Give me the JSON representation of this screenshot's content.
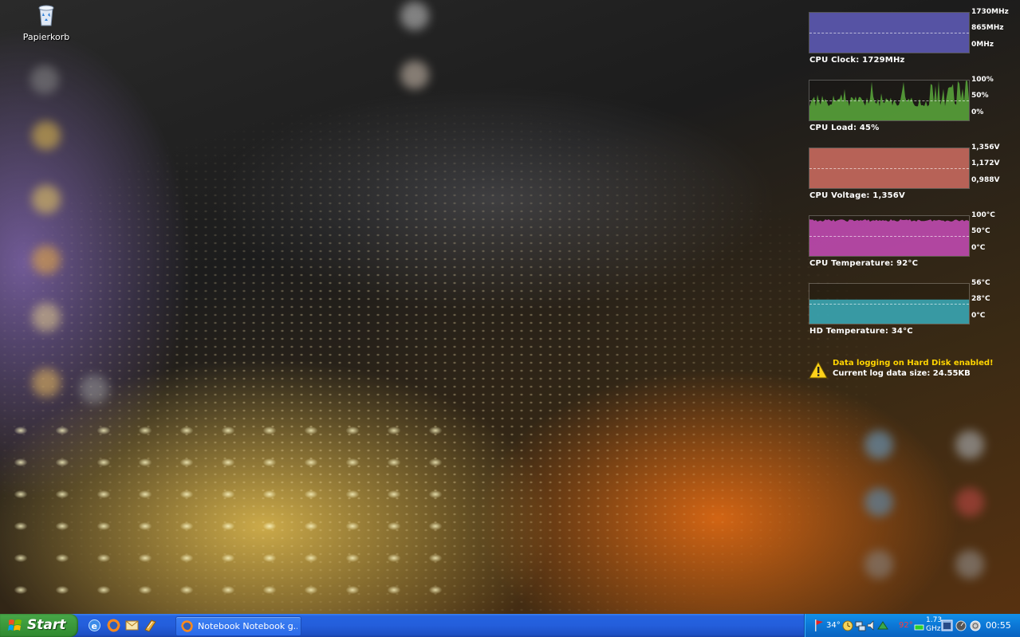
{
  "desktop": {
    "recycle_bin_label": "Papierkorb"
  },
  "monitors": [
    {
      "caption": "CPU Clock: 1729MHz",
      "ticks": [
        "1730MHz",
        "865MHz",
        "0MHz"
      ],
      "color": "#5d5ab4",
      "level": 1.0,
      "kind": "flat"
    },
    {
      "caption": "CPU Load: 45%",
      "ticks": [
        "100%",
        "50%",
        "0%"
      ],
      "color": "#58a23a",
      "level": 0.45,
      "kind": "spiky"
    },
    {
      "caption": "CPU Voltage: 1,356V",
      "ticks": [
        "1,356V",
        "1,172V",
        "0,988V"
      ],
      "color": "#c86a5e",
      "level": 1.0,
      "kind": "flat"
    },
    {
      "caption": "CPU Temperature: 92°C",
      "ticks": [
        "100°C",
        "50°C",
        "0°C"
      ],
      "color": "#c04ab0",
      "level": 0.92,
      "kind": "noisy"
    },
    {
      "caption": "HD Temperature: 34°C",
      "ticks": [
        "56°C",
        "28°C",
        "0°C"
      ],
      "color": "#3aa6b4",
      "level": 0.607,
      "kind": "flat"
    }
  ],
  "notice": {
    "line1": "Data logging on Hard Disk enabled!",
    "line2": "Current log data size: 24.55KB"
  },
  "taskbar": {
    "start_label": "Start",
    "task_title": "Notebook Notebook g...",
    "tray_temp": "34°",
    "tray_cpu_temp": "92°",
    "tray_freq_top": "1.73",
    "tray_freq_bottom": "GHz",
    "clock": "00:55"
  }
}
